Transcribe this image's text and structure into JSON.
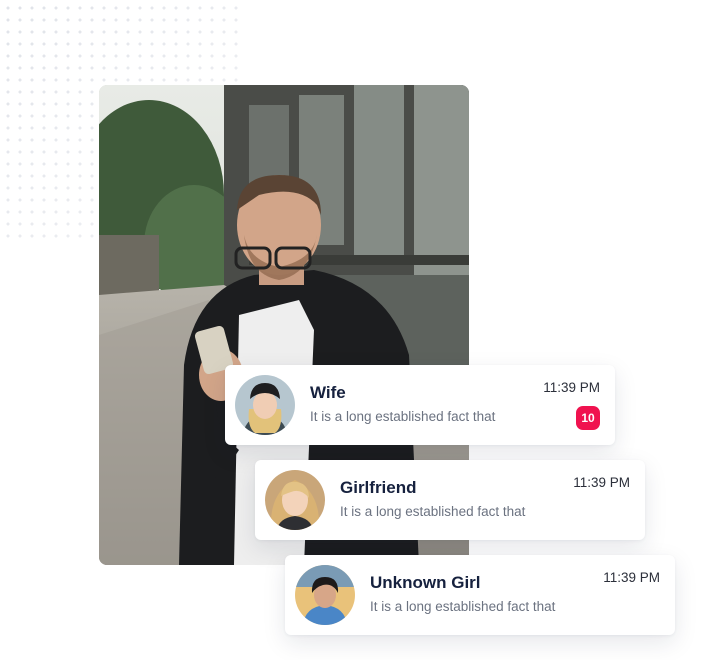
{
  "colors": {
    "name_text": "#16213e",
    "message_text": "#6b7280",
    "badge_bg": "#f0124f",
    "badge_text": "#ffffff"
  },
  "hero_image": {
    "icon": "person-with-phone-photo"
  },
  "chats": [
    {
      "name": "Wife",
      "message": "It is a long established fact that",
      "time": "11:39 PM",
      "unread": "10",
      "avatar": "woman-with-beanie-avatar"
    },
    {
      "name": "Girlfriend",
      "message": "It is a long established fact that",
      "time": "11:39 PM",
      "avatar": "blonde-woman-avatar"
    },
    {
      "name": "Unknown Girl",
      "message": "It is a long established fact that",
      "time": "11:39 PM",
      "avatar": "girl-in-blue-avatar"
    }
  ]
}
